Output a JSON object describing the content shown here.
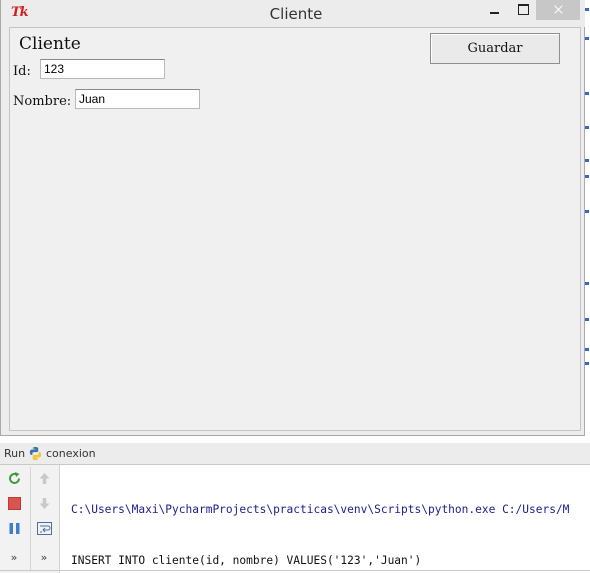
{
  "tk_window": {
    "icon_text": "Tk",
    "title": "Cliente",
    "form": {
      "heading": "Cliente",
      "id_label": "Id:",
      "id_value": "123",
      "nombre_label": "Nombre:",
      "nombre_value": "Juan",
      "save_label": "Guardar"
    }
  },
  "run_panel": {
    "tab_label": "Run",
    "config_name": "conexion",
    "console_lines": [
      "C:\\Users\\Maxi\\PycharmProjects\\practicas\\venv\\Scripts\\python.exe C:/Users/M",
      "INSERT INTO cliente(id, nombre) VALUES('123','Juan')"
    ],
    "toolbar_icons": [
      "rerun-icon",
      "stop-icon",
      "pause-icon",
      "expand-icon",
      "up-arrow-icon",
      "down-arrow-icon",
      "soft-wrap-icon",
      "expand-icon"
    ],
    "expand_glyph": "»"
  },
  "colors": {
    "close_button": "#c7c7c7",
    "tk_icon": "#d11f1f",
    "console_path": "#1c1c8f",
    "rerun": "#3e9a3e",
    "stop": "#d9534f",
    "pause": "#3d7fc9"
  }
}
